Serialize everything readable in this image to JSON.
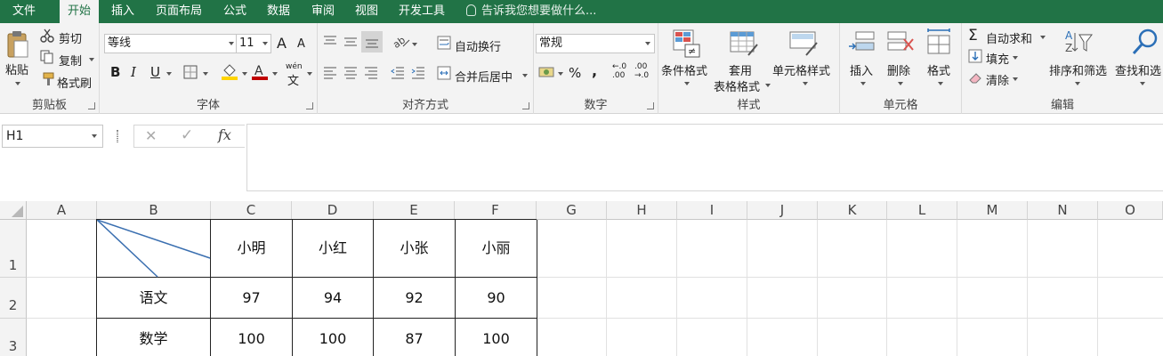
{
  "menu": {
    "file": "文件",
    "home": "开始",
    "insert": "插入",
    "page_layout": "页面布局",
    "formulas": "公式",
    "data": "数据",
    "review": "审阅",
    "view": "视图",
    "developer": "开发工具",
    "tell_me": "告诉我您想要做什么..."
  },
  "clipboard": {
    "paste": "粘贴",
    "cut": "剪切",
    "copy": "复制",
    "format_painter": "格式刷",
    "label": "剪贴板"
  },
  "font": {
    "name": "等线",
    "size": "11",
    "label": "字体",
    "bold": "B",
    "italic": "I",
    "underline": "U",
    "grow": "A",
    "shrink": "A",
    "phonetic": "wén"
  },
  "alignment": {
    "wrap_text": "自动换行",
    "merge_center": "合并后居中",
    "label": "对齐方式"
  },
  "number": {
    "format": "常规",
    "percent": "%",
    "comma": ",",
    "inc_decimal": "←.0 .00",
    "dec_decimal": ".00 →.0",
    "label": "数字"
  },
  "styles": {
    "conditional": "条件格式",
    "table_format_1": "套用",
    "table_format_2": "表格格式",
    "cell_styles": "单元格样式",
    "label": "样式"
  },
  "cells": {
    "insert": "插入",
    "delete": "删除",
    "format": "格式",
    "label": "单元格"
  },
  "editing": {
    "autosum": "自动求和",
    "fill": "填充",
    "clear": "清除",
    "sort_filter": "排序和筛选",
    "find_select": "查找和选",
    "label": "编辑"
  },
  "formula_bar": {
    "name_box": "H1",
    "fx": "fx",
    "value": ""
  },
  "columns": [
    "A",
    "B",
    "C",
    "D",
    "E",
    "F",
    "G",
    "H",
    "I",
    "J",
    "K",
    "L",
    "M",
    "N",
    "O"
  ],
  "rows": [
    {
      "num": "1",
      "cells": [
        "",
        "",
        "小明",
        "小红",
        "小张",
        "小丽"
      ]
    },
    {
      "num": "2",
      "cells": [
        "",
        "语文",
        "97",
        "94",
        "92",
        "90"
      ]
    },
    {
      "num": "3",
      "cells": [
        "",
        "数学",
        "100",
        "100",
        "87",
        "100"
      ]
    }
  ],
  "colors": {
    "accent": "#217346",
    "ribbon_bg": "#f3f3f3",
    "grid_line": "#e1e1e1",
    "diagonal": "#3a6fb0"
  }
}
